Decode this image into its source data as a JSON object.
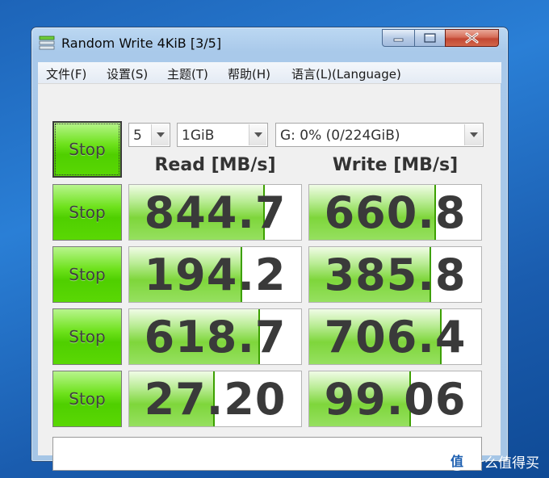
{
  "window": {
    "title": "Random Write 4KiB [3/5]"
  },
  "menu": [
    {
      "label": "文件(F)"
    },
    {
      "label": "设置(S)"
    },
    {
      "label": "主题(T)"
    },
    {
      "label": "帮助(H)"
    },
    {
      "label": "语言(L)(Language)"
    }
  ],
  "controls": {
    "all_button": "Stop",
    "count": "5",
    "size": "1GiB",
    "drive": "G: 0% (0/224GiB)"
  },
  "headers": {
    "read": "Read [MB/s]",
    "write": "Write [MB/s]"
  },
  "rows": [
    {
      "button": "Stop",
      "read": "844.7",
      "write": "660.8",
      "read_fill": 0.78,
      "write_fill": 0.73
    },
    {
      "button": "Stop",
      "read": "194.2",
      "write": "385.8",
      "read_fill": 0.65,
      "write_fill": 0.7
    },
    {
      "button": "Stop",
      "read": "618.7",
      "write": "706.4",
      "read_fill": 0.75,
      "write_fill": 0.76
    },
    {
      "button": "Stop",
      "read": "27.20",
      "write": "99.06",
      "read_fill": 0.49,
      "write_fill": 0.58
    }
  ],
  "comment": "",
  "watermark": {
    "badge": "值",
    "text": "什么值得买"
  },
  "colors": {
    "button_green": "#5ad804",
    "bar_green": "#7ed63b",
    "desktop_blue": "#2a7fd6",
    "close_red": "#c24732"
  }
}
